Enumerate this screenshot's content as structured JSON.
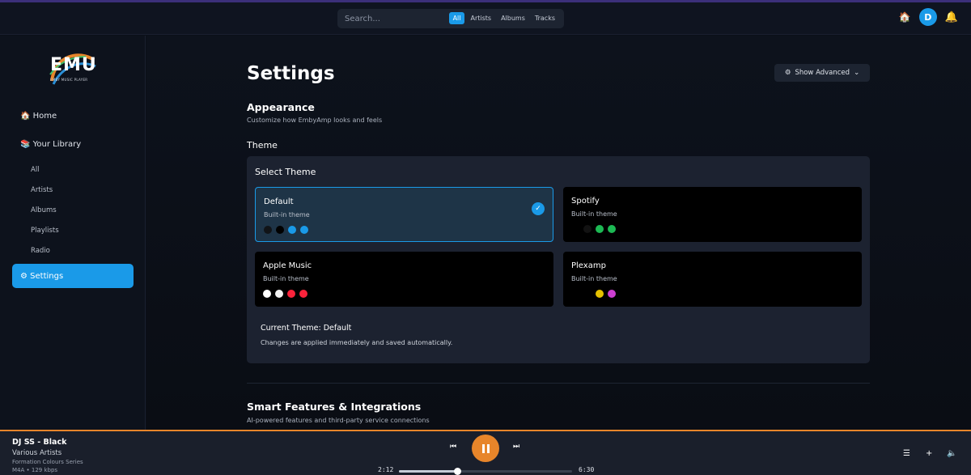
{
  "search": {
    "placeholder": "Search...",
    "filters": [
      "All",
      "Artists",
      "Albums",
      "Tracks"
    ],
    "active_filter": "All"
  },
  "user": {
    "avatar_letter": "D"
  },
  "logo": {
    "text": "EMU",
    "subtitle": "EMBY MUSIC PLAYER"
  },
  "sidebar": {
    "home": "🏠 Home",
    "library": "📚 Your Library",
    "sub_items": [
      "All",
      "Artists",
      "Albums",
      "Playlists",
      "Radio"
    ],
    "settings": "⚙ Settings"
  },
  "page": {
    "title": "Settings",
    "advanced_label": "Show Advanced",
    "appearance_title": "Appearance",
    "appearance_desc": "Customize how EmbyAmp looks and feels",
    "theme_label": "Theme",
    "select_theme": "Select Theme",
    "themes": [
      {
        "name": "Default",
        "sub": "Built-in theme",
        "colors": [
          "#111418",
          "#000000",
          "#1a9ae8",
          "#1a9ae8"
        ],
        "selected": true
      },
      {
        "name": "Spotify",
        "sub": "Built-in theme",
        "colors": [
          "#000000",
          "#121212",
          "#1db954",
          "#1db954"
        ],
        "selected": false
      },
      {
        "name": "Apple Music",
        "sub": "Built-in theme",
        "colors": [
          "#ffffff",
          "#f2f2f2",
          "#fa233b",
          "#fa233b"
        ],
        "selected": false
      },
      {
        "name": "Plexamp",
        "sub": "Built-in theme",
        "colors": [
          "#000000",
          "#000000",
          "#e5c100",
          "#cc3fd1"
        ],
        "selected": false
      }
    ],
    "current_theme": "Current Theme: Default",
    "changes_note": "Changes are applied immediately and saved automatically.",
    "smart_title": "Smart Features & Integrations",
    "smart_desc": "AI-powered features and third-party service connections"
  },
  "player": {
    "title": "DJ SS - Black",
    "artist": "Various Artists",
    "album": "Formation Colours Series",
    "format": "M4A • 129 kbps",
    "elapsed": "2:12",
    "duration": "6:30",
    "progress": 0.34
  }
}
